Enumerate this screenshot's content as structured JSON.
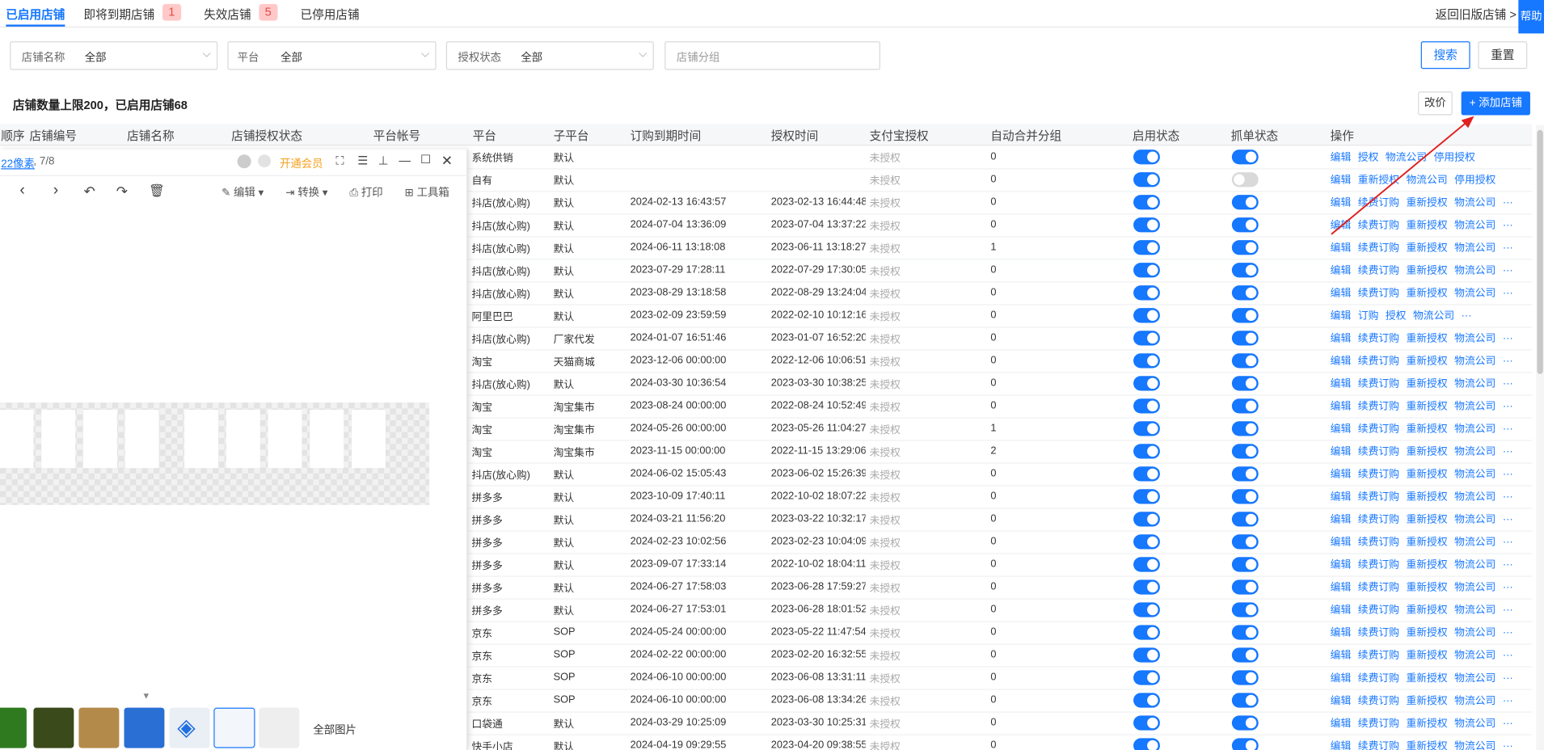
{
  "tabs": [
    {
      "label": "已启用店铺"
    },
    {
      "label": "即将到期店铺",
      "badge": "1"
    },
    {
      "label": "失效店铺",
      "badge": "5"
    },
    {
      "label": "已停用店铺"
    }
  ],
  "back_link": "返回旧版店铺 >",
  "help": "帮助",
  "filters": {
    "shop_name": {
      "label": "店铺名称",
      "value": "全部"
    },
    "platform": {
      "label": "平台",
      "value": "全部"
    },
    "auth_status": {
      "label": "授权状态",
      "value": "全部"
    },
    "shop_group": {
      "placeholder": "店铺分组"
    }
  },
  "buttons": {
    "search": "搜索",
    "reset": "重置",
    "reprice": "改价",
    "add_shop": "+ 添加店铺"
  },
  "info": "店铺数量上限200，已启用店铺68",
  "columns": [
    "顺序",
    "店铺编号",
    "店铺名称",
    "店铺授权状态",
    "平台帐号",
    "平台",
    "子平台",
    "订购到期时间",
    "授权时间",
    "支付宝授权",
    "自动合并分组",
    "启用状态",
    "抓单状态",
    "操作"
  ],
  "rows": [
    {
      "platform": "系统供销",
      "sub": "默认",
      "expire": "",
      "auth": "",
      "alipay": "未授权",
      "merge": "0",
      "enabled": true,
      "grab": true,
      "ops": [
        "编辑",
        "授权",
        "物流公司",
        "停用授权"
      ]
    },
    {
      "platform": "自有",
      "sub": "默认",
      "expire": "",
      "auth": "",
      "alipay": "未授权",
      "merge": "0",
      "enabled": true,
      "grab": false,
      "ops": [
        "编辑",
        "重新授权",
        "物流公司",
        "停用授权"
      ]
    },
    {
      "platform": "抖店(放心购)",
      "sub": "默认",
      "expire": "2024-02-13 16:43:57",
      "auth": "2023-02-13 16:44:48",
      "alipay": "未授权",
      "merge": "0",
      "enabled": true,
      "grab": true,
      "ops": [
        "编辑",
        "续费订购",
        "重新授权",
        "物流公司",
        "···"
      ]
    },
    {
      "platform": "抖店(放心购)",
      "sub": "默认",
      "expire": "2024-07-04 13:36:09",
      "auth": "2023-07-04 13:37:22",
      "alipay": "未授权",
      "merge": "0",
      "enabled": true,
      "grab": true,
      "ops": [
        "编辑",
        "续费订购",
        "重新授权",
        "物流公司",
        "···"
      ]
    },
    {
      "platform": "抖店(放心购)",
      "sub": "默认",
      "expire": "2024-06-11 13:18:08",
      "auth": "2023-06-11 13:18:27",
      "alipay": "未授权",
      "merge": "1",
      "enabled": true,
      "grab": true,
      "ops": [
        "编辑",
        "续费订购",
        "重新授权",
        "物流公司",
        "···"
      ]
    },
    {
      "platform": "抖店(放心购)",
      "sub": "默认",
      "expire": "2023-07-29 17:28:11",
      "auth": "2022-07-29 17:30:05",
      "alipay": "未授权",
      "merge": "0",
      "enabled": true,
      "grab": true,
      "ops": [
        "编辑",
        "续费订购",
        "重新授权",
        "物流公司",
        "···"
      ]
    },
    {
      "platform": "抖店(放心购)",
      "sub": "默认",
      "expire": "2023-08-29 13:18:58",
      "auth": "2022-08-29 13:24:04",
      "alipay": "未授权",
      "merge": "0",
      "enabled": true,
      "grab": true,
      "ops": [
        "编辑",
        "续费订购",
        "重新授权",
        "物流公司",
        "···"
      ]
    },
    {
      "platform": "阿里巴巴",
      "sub": "默认",
      "expire": "2023-02-09 23:59:59",
      "auth": "2022-02-10 10:12:16",
      "alipay": "未授权",
      "merge": "0",
      "enabled": true,
      "grab": true,
      "ops": [
        "编辑",
        "订购",
        "授权",
        "物流公司",
        "···"
      ]
    },
    {
      "platform": "抖店(放心购)",
      "sub": "厂家代发",
      "expire": "2024-01-07 16:51:46",
      "auth": "2023-01-07 16:52:20",
      "alipay": "未授权",
      "merge": "0",
      "enabled": true,
      "grab": true,
      "ops": [
        "编辑",
        "续费订购",
        "重新授权",
        "物流公司",
        "···"
      ]
    },
    {
      "platform": "淘宝",
      "sub": "天猫商城",
      "expire": "2023-12-06 00:00:00",
      "auth": "2022-12-06 10:06:51",
      "alipay": "未授权",
      "merge": "0",
      "enabled": true,
      "grab": true,
      "ops": [
        "编辑",
        "续费订购",
        "重新授权",
        "物流公司",
        "···"
      ]
    },
    {
      "platform": "抖店(放心购)",
      "sub": "默认",
      "expire": "2024-03-30 10:36:54",
      "auth": "2023-03-30 10:38:25",
      "alipay": "未授权",
      "merge": "0",
      "enabled": true,
      "grab": true,
      "ops": [
        "编辑",
        "续费订购",
        "重新授权",
        "物流公司",
        "···"
      ]
    },
    {
      "platform": "淘宝",
      "sub": "淘宝集市",
      "expire": "2023-08-24 00:00:00",
      "auth": "2022-08-24 10:52:49",
      "alipay": "未授权",
      "merge": "0",
      "enabled": true,
      "grab": true,
      "ops": [
        "编辑",
        "续费订购",
        "重新授权",
        "物流公司",
        "···"
      ]
    },
    {
      "platform": "淘宝",
      "sub": "淘宝集市",
      "expire": "2024-05-26 00:00:00",
      "auth": "2023-05-26 11:04:27",
      "alipay": "未授权",
      "merge": "1",
      "enabled": true,
      "grab": true,
      "ops": [
        "编辑",
        "续费订购",
        "重新授权",
        "物流公司",
        "···"
      ]
    },
    {
      "platform": "淘宝",
      "sub": "淘宝集市",
      "expire": "2023-11-15 00:00:00",
      "auth": "2022-11-15 13:29:06",
      "alipay": "未授权",
      "merge": "2",
      "enabled": true,
      "grab": true,
      "ops": [
        "编辑",
        "续费订购",
        "重新授权",
        "物流公司",
        "···"
      ]
    },
    {
      "platform": "抖店(放心购)",
      "sub": "默认",
      "expire": "2024-06-02 15:05:43",
      "auth": "2023-06-02 15:26:39",
      "alipay": "未授权",
      "merge": "0",
      "enabled": true,
      "grab": true,
      "ops": [
        "编辑",
        "续费订购",
        "重新授权",
        "物流公司",
        "···"
      ]
    },
    {
      "platform": "拼多多",
      "sub": "默认",
      "expire": "2023-10-09 17:40:11",
      "auth": "2022-10-02 18:07:22",
      "alipay": "未授权",
      "merge": "0",
      "enabled": true,
      "grab": true,
      "ops": [
        "编辑",
        "续费订购",
        "重新授权",
        "物流公司",
        "···"
      ]
    },
    {
      "platform": "拼多多",
      "sub": "默认",
      "expire": "2024-03-21 11:56:20",
      "auth": "2023-03-22 10:32:17",
      "alipay": "未授权",
      "merge": "0",
      "enabled": true,
      "grab": true,
      "ops": [
        "编辑",
        "续费订购",
        "重新授权",
        "物流公司",
        "···"
      ]
    },
    {
      "platform": "拼多多",
      "sub": "默认",
      "expire": "2024-02-23 10:02:56",
      "auth": "2023-02-23 10:04:09",
      "alipay": "未授权",
      "merge": "0",
      "enabled": true,
      "grab": true,
      "ops": [
        "编辑",
        "续费订购",
        "重新授权",
        "物流公司",
        "···"
      ]
    },
    {
      "platform": "拼多多",
      "sub": "默认",
      "expire": "2023-09-07 17:33:14",
      "auth": "2022-10-02 18:04:11",
      "alipay": "未授权",
      "merge": "0",
      "enabled": true,
      "grab": true,
      "ops": [
        "编辑",
        "续费订购",
        "重新授权",
        "物流公司",
        "···"
      ]
    },
    {
      "platform": "拼多多",
      "sub": "默认",
      "expire": "2024-06-27 17:58:03",
      "auth": "2023-06-28 17:59:27",
      "alipay": "未授权",
      "merge": "0",
      "enabled": true,
      "grab": true,
      "ops": [
        "编辑",
        "续费订购",
        "重新授权",
        "物流公司",
        "···"
      ]
    },
    {
      "platform": "拼多多",
      "sub": "默认",
      "expire": "2024-06-27 17:53:01",
      "auth": "2023-06-28 18:01:52",
      "alipay": "未授权",
      "merge": "0",
      "enabled": true,
      "grab": true,
      "ops": [
        "编辑",
        "续费订购",
        "重新授权",
        "物流公司",
        "···"
      ]
    },
    {
      "platform": "京东",
      "sub": "SOP",
      "expire": "2024-05-24 00:00:00",
      "auth": "2023-05-22 11:47:54",
      "alipay": "未授权",
      "merge": "0",
      "enabled": true,
      "grab": true,
      "ops": [
        "编辑",
        "续费订购",
        "重新授权",
        "物流公司",
        "···"
      ]
    },
    {
      "platform": "京东",
      "sub": "SOP",
      "expire": "2024-02-22 00:00:00",
      "auth": "2023-02-20 16:32:55",
      "alipay": "未授权",
      "merge": "0",
      "enabled": true,
      "grab": true,
      "ops": [
        "编辑",
        "续费订购",
        "重新授权",
        "物流公司",
        "···"
      ]
    },
    {
      "platform": "京东",
      "sub": "SOP",
      "expire": "2024-06-10 00:00:00",
      "auth": "2023-06-08 13:31:11",
      "alipay": "未授权",
      "merge": "0",
      "enabled": true,
      "grab": true,
      "ops": [
        "编辑",
        "续费订购",
        "重新授权",
        "物流公司",
        "···"
      ]
    },
    {
      "platform": "京东",
      "sub": "SOP",
      "expire": "2024-06-10 00:00:00",
      "auth": "2023-06-08 13:34:26",
      "alipay": "未授权",
      "merge": "0",
      "enabled": true,
      "grab": true,
      "ops": [
        "编辑",
        "续费订购",
        "重新授权",
        "物流公司",
        "···"
      ]
    },
    {
      "platform": "口袋通",
      "sub": "默认",
      "expire": "2024-03-29 10:25:09",
      "auth": "2023-03-30 10:25:31",
      "alipay": "未授权",
      "merge": "0",
      "enabled": true,
      "grab": true,
      "ops": [
        "编辑",
        "续费订购",
        "重新授权",
        "物流公司",
        "···"
      ]
    },
    {
      "platform": "快手小店",
      "sub": "默认",
      "expire": "2024-04-19 09:29:55",
      "auth": "2023-04-20 09:38:55",
      "alipay": "未授权",
      "merge": "0",
      "enabled": true,
      "grab": true,
      "ops": [
        "编辑",
        "续费订购",
        "重新授权",
        "物流公司",
        "···"
      ]
    }
  ],
  "viewer": {
    "info_link": "22像素",
    "page_counter": ", 7/8",
    "vip": "开通会员",
    "toolbar": {
      "edit": "编辑",
      "convert": "转换",
      "print": "打印",
      "toolbox": "工具箱"
    },
    "all_images": "全部图片",
    "accent": "#f4a11d"
  },
  "colors": {
    "primary": "#1677ff",
    "badge_bg": "#ffc9c9",
    "badge_text": "#e34d4d",
    "annotation_arrow": "#e02020"
  }
}
